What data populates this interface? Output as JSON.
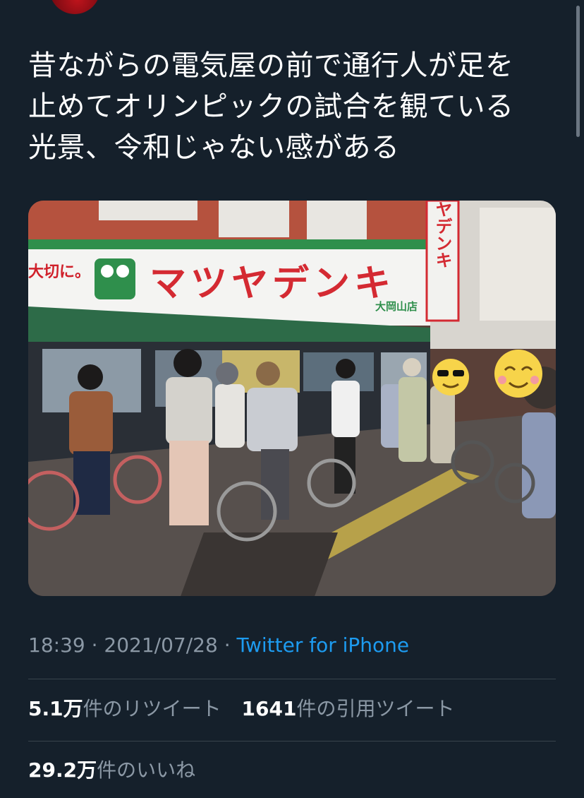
{
  "tweet": {
    "text": "昔ながらの電気屋の前で通行人が足を\n止めてオリンピックの試合を観ている\n光景、令和じゃない感がある",
    "photo": {
      "sign_text": "マツヤデンキ",
      "sign_left_text": "大切に。",
      "branch_text": "大岡山店",
      "vertical_sign_text": "マツヤデンキ"
    },
    "meta": {
      "time": "18:39",
      "separator": " · ",
      "date": "2021/07/28",
      "source": "Twitter for iPhone"
    },
    "stats": {
      "retweets_count": "5.1万",
      "retweets_label": "件のリツイート",
      "quotes_count": "1641",
      "quotes_label": "件の引用ツイート",
      "likes_count": "29.2万",
      "likes_label": "件のいいね"
    }
  },
  "colors": {
    "background": "#15202b",
    "text": "#ffffff",
    "secondary_text": "#8b98a5",
    "link": "#1d9bf0",
    "divider": "#38444d"
  }
}
